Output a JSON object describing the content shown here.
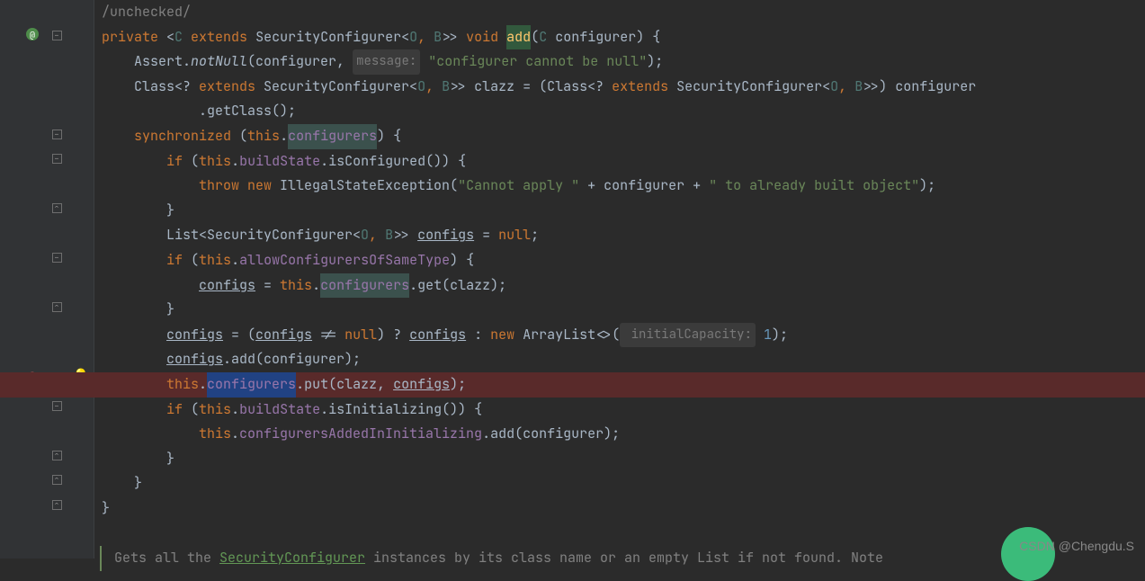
{
  "watermark": "CSDN @Chengdu.S",
  "bottom_doc": {
    "prefix": "Gets all the ",
    "link": "SecurityConfigurer",
    "suffix": " instances by its class name or an empty List if not found. Note"
  },
  "code": {
    "l1": "/unchecked/",
    "l2": {
      "kw_private": "private",
      "generic_open": " <",
      "C": "C",
      "extends": " extends ",
      "t_sc": "SecurityConfigurer<",
      "O": "O",
      "comma1": ", ",
      "B": "B",
      "gend": ">> ",
      "void": "void ",
      "add": "add",
      "paren_open": "(",
      "C2": "C",
      "arg": " configurer) {"
    },
    "l3": {
      "indent": "    ",
      "assert": "Assert.",
      "notnull": "notNull",
      "open": "(configurer, ",
      "hint": "message:",
      "str": " \"configurer cannot be null\"",
      "end": ");"
    },
    "l4": {
      "indent": "    ",
      "pre": "Class<? ",
      "extends": "extends ",
      "sc": "SecurityConfigurer<",
      "O": "O",
      "c1": ", ",
      "B": "B",
      "mid": ">> clazz = (Class<? ",
      "extends2": "extends ",
      "sc2": "SecurityConfigurer<",
      "O2": "O",
      "c2": ", ",
      "B2": "B",
      "end": ">>) configurer"
    },
    "l5": {
      "indent": "            ",
      "text": ".getClass();"
    },
    "l6": {
      "indent": "    ",
      "sync": "synchronized ",
      "open": "(",
      "this": "this",
      "dot": ".",
      "field": "configurers",
      "end": ") {"
    },
    "l7": {
      "indent": "        ",
      "if": "if ",
      "open": "(",
      "this": "this",
      "dot": ".",
      "field": "buildState",
      "end": ".isConfigured()) {"
    },
    "l8": {
      "indent": "            ",
      "throw": "throw ",
      "new": "new ",
      "exc": "IllegalStateException(",
      "s1": "\"Cannot apply \"",
      "p1": " + configurer + ",
      "s2": "\" to already built object\"",
      "end": ");"
    },
    "l9": "        }",
    "l10": {
      "indent": "        ",
      "pre": "List<SecurityConfigurer<",
      "O": "O",
      "c1": ", ",
      "B": "B",
      "mid": ">> ",
      "var": "configs",
      "eq": " = ",
      "null": "null",
      "semi": ";"
    },
    "l11": {
      "indent": "        ",
      "if": "if ",
      "open": "(",
      "this": "this",
      "dot": ".",
      "field": "allowConfigurersOfSameType",
      "end": ") {"
    },
    "l12": {
      "indent": "            ",
      "var": "configs",
      "eq": " = ",
      "this": "this",
      "dot": ".",
      "field": "configurers",
      "call": ".get(clazz);"
    },
    "l13": "        }",
    "l14": {
      "indent": "        ",
      "var": "configs",
      "eq": " = (",
      "var2": "configs",
      "neq": " != ",
      "null": "null",
      "q": ") ? ",
      "var3": "configs",
      "colon": " : ",
      "new": "new ",
      "arr": "ArrayList<>(",
      "hint": " initialCapacity:",
      "num": " 1",
      "end": ");"
    },
    "l15": {
      "indent": "        ",
      "var": "configs",
      "call": ".add(configurer);"
    },
    "l16": {
      "indent": "        ",
      "this": "this",
      "dot": ".",
      "field": "configurers",
      "call": ".put(clazz, ",
      "var": "configs",
      "end": ");"
    },
    "l17": {
      "indent": "        ",
      "if": "if ",
      "open": "(",
      "this": "this",
      "dot": ".",
      "field": "buildState",
      "end": ".isInitializing()) {"
    },
    "l18": {
      "indent": "            ",
      "this": "this",
      "dot": ".",
      "field": "configurersAddedInInitializing",
      "call": ".add(configurer);"
    },
    "l19": "        }",
    "l20": "    }",
    "l21": "}"
  }
}
